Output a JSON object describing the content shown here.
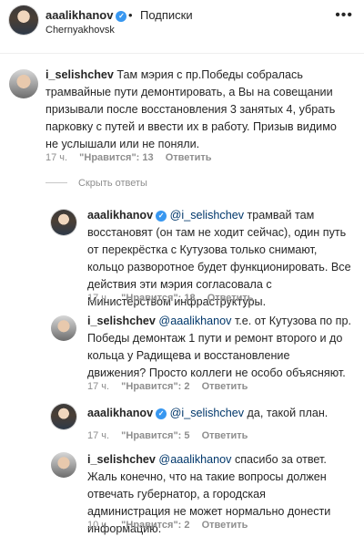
{
  "header": {
    "username": "aaalikhanov",
    "dot": "•",
    "follow_label": "Подписки",
    "location": "Chernyakhovsk",
    "more_icon": "more-horizontal-icon"
  },
  "comments": [
    {
      "user": "i_selishchev",
      "mention": "",
      "text": "Там мэрия с пр.Победы собралась трамвайные пути демонтировать, а Вы на совещании призывали после восстановления 3 занятых 4, убрать парковку с путей и ввести их в работу. Призыв видимо не услышали или не поняли.",
      "time": "17 ч.",
      "likes": "\"Нравится\": 13",
      "reply": "Ответить"
    }
  ],
  "hide_replies": "Скрыть ответы",
  "replies": [
    {
      "user": "aaalikhanov",
      "verified": true,
      "mention": "@i_selishchev",
      "text": "трамвай там восстановят (он там не ходит сейчас), один путь от перекрёстка с Кутузова только снимают, кольцо разворотное будет функционировать. Все действия эти мэрия согласовала с Министерством инфраструктуры.",
      "time": "17 ч.",
      "likes": "\"Нравится\": 18",
      "reply": "Ответить"
    },
    {
      "user": "i_selishchev",
      "verified": false,
      "mention": "@aaalikhanov",
      "text": "т.е. от Кутузова по пр. Победы демонтаж 1 пути и ремонт второго и до кольца у Радищева и восстановление движения? Просто коллеги не особо объясняют.",
      "time": "17 ч.",
      "likes": "\"Нравится\": 2",
      "reply": "Ответить"
    },
    {
      "user": "aaalikhanov",
      "verified": true,
      "mention": "@i_selishchev",
      "text": "да, такой план.",
      "time": "17 ч.",
      "likes": "\"Нравится\": 5",
      "reply": "Ответить"
    },
    {
      "user": "i_selishchev",
      "verified": false,
      "mention": "@aaalikhanov",
      "text": "спасибо за ответ. Жаль конечно, что на такие вопросы должен отвечать губернатор, а городская администрация не может нормально донести информацию.",
      "time": "10 ч.",
      "likes": "\"Нравится\": 2",
      "reply": "Ответить"
    }
  ]
}
